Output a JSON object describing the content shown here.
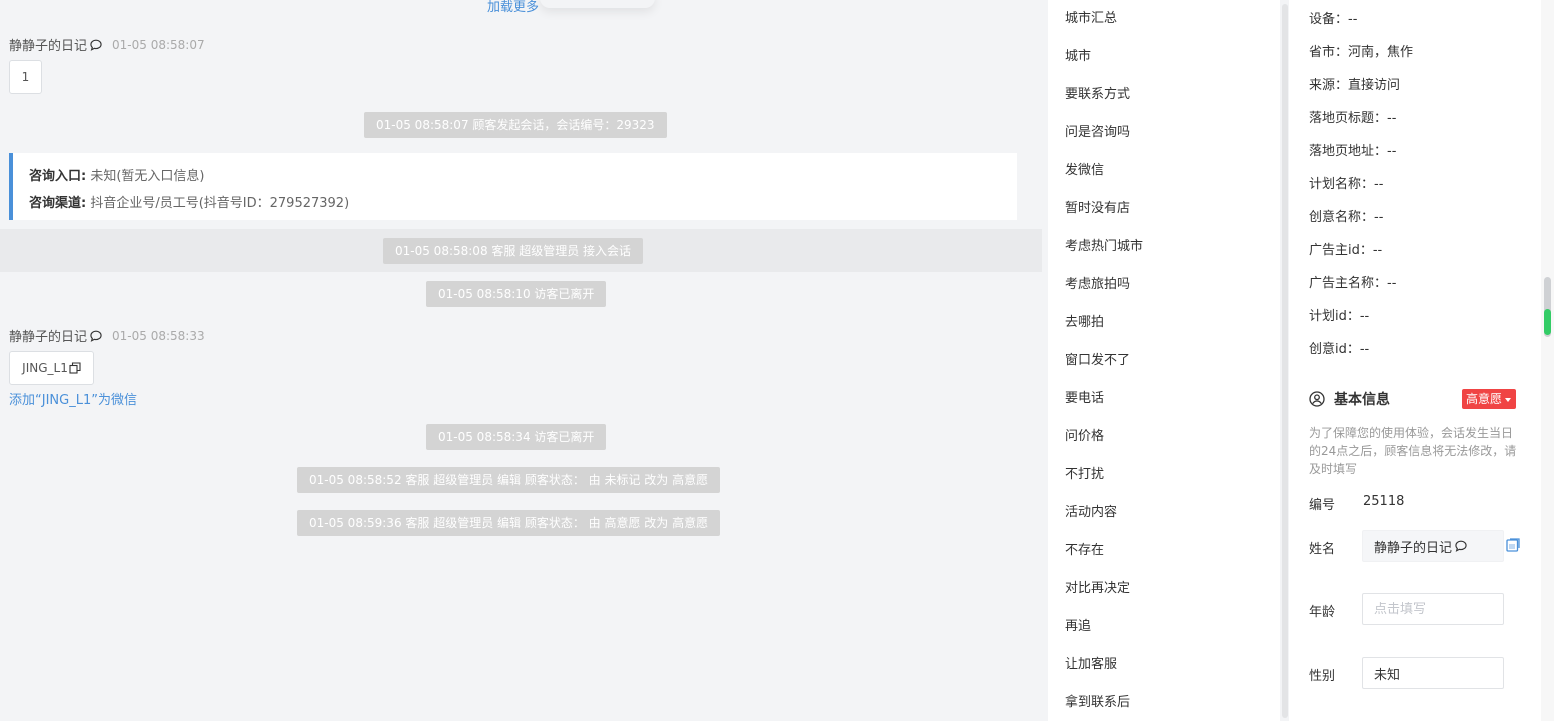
{
  "chat": {
    "load_more": "加载更多",
    "messages": [
      {
        "sender": "静静子的日记",
        "time": "01-05 08:58:07",
        "content": "1"
      },
      {
        "sender": "静静子的日记",
        "time": "01-05 08:58:33",
        "content": "JING_L1"
      }
    ],
    "add_wechat": "添加“JING_L1”为微信",
    "system": [
      "01-05 08:58:07 顾客发起会话，会话编号：29323",
      "01-05 08:58:08 客服 超级管理员 接入会话",
      "01-05 08:58:10 访客已离开",
      "01-05 08:58:34 访客已离开",
      "01-05 08:58:52 客服 超级管理员 编辑 顾客状态： 由 未标记 改为 高意愿",
      "01-05 08:59:36 客服 超级管理员 编辑 顾客状态： 由 高意愿 改为 高意愿"
    ],
    "info_card": {
      "entry_label": "咨询入口:",
      "entry_value": "未知(暂无入口信息)",
      "channel_label": "咨询渠道:",
      "channel_value": "抖音企业号/员工号(抖音号ID：279527392)"
    }
  },
  "quick_replies": [
    "城市汇总",
    "城市",
    "要联系方式",
    "问是咨询吗",
    "发微信",
    "暂时没有店",
    "考虑热门城市",
    "考虑旅拍吗",
    "去哪拍",
    "窗口发不了",
    "要电话",
    "问价格",
    "不打扰",
    "活动内容",
    "不存在",
    "对比再决定",
    "再追",
    "让加客服",
    "拿到联系后"
  ],
  "panel": {
    "attributes": [
      "设备：--",
      "省市：河南，焦作",
      "来源：直接访问",
      "落地页标题：--",
      "落地页地址：--",
      "计划名称：--",
      "创意名称：--",
      "广告主id：--",
      "广告主名称：--",
      "计划id：--",
      "创意id：--"
    ],
    "basic_info": {
      "title": "基本信息",
      "intent_badge": "高意愿",
      "notice": "为了保障您的使用体验，会话发生当日的24点之后，顾客信息将无法修改，请及时填写",
      "number_label": "编号",
      "number_value": "25118",
      "name_label": "姓名",
      "name_value": "静静子的日记",
      "age_label": "年龄",
      "age_placeholder": "点击填写",
      "gender_label": "性别",
      "gender_value": "未知"
    }
  },
  "colors": {
    "accent": "#4a90d9",
    "badge_red": "#f04444",
    "system_gray": "#d4d4d4",
    "scroll_green": "#33cc66"
  }
}
